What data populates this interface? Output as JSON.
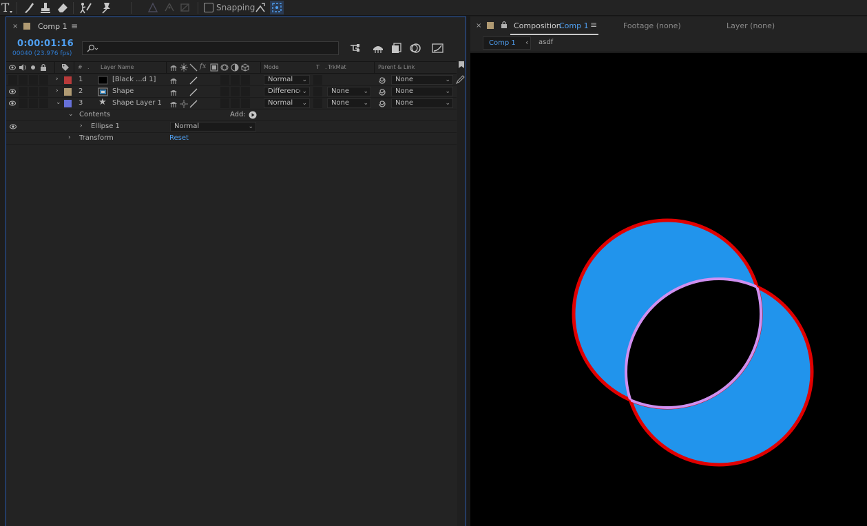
{
  "toolbar": {
    "snapping_label": "Snapping",
    "tools": [
      "type-tool",
      "brush-tool",
      "clone-stamp-tool",
      "eraser-tool",
      "roto-brush-tool",
      "puppet-pin-tool"
    ]
  },
  "timeline": {
    "tab_title": "Comp 1",
    "timecode": "0:00:01:16",
    "frames": "00040 (23.976 fps)",
    "columns": {
      "number": "#",
      "layer_name": "Layer Name",
      "mode": "Mode",
      "t": "T",
      "trkmat": "TrkMat",
      "parent": "Parent & Link"
    },
    "layers": [
      {
        "num": "1",
        "name": "[Black ...d 1]",
        "label_color": "#b83a3a",
        "mode": "Normal",
        "trkmat": "",
        "parent": "None"
      },
      {
        "num": "2",
        "name": "Shape",
        "label_color": "#b09a72",
        "mode": "Difference",
        "trkmat": "None",
        "parent": "None"
      },
      {
        "num": "3",
        "name": "Shape Layer 1",
        "label_color": "#6670d8",
        "mode": "Normal",
        "trkmat": "None",
        "parent": "None"
      }
    ],
    "contents_label": "Contents",
    "add_label": "Add:",
    "ellipse": {
      "name": "Ellipse 1",
      "mode": "Normal"
    },
    "transform": {
      "name": "Transform",
      "reset": "Reset"
    }
  },
  "viewer": {
    "composition_label": "Composition",
    "composition_name": "Comp 1",
    "footage_tab": "Footage (none)",
    "layer_tab": "Layer (none)",
    "breadcrumb": [
      "Comp 1",
      "asdf"
    ],
    "colors": {
      "fill": "#2194ec",
      "stroke_outer": "#e00000",
      "stroke_inner": "#cf8ff0",
      "background": "#000000"
    }
  },
  "colors": {
    "accent_blue": "#4f9ff0",
    "panel_bg": "#232323",
    "panel_border": "#2b5cb0"
  }
}
